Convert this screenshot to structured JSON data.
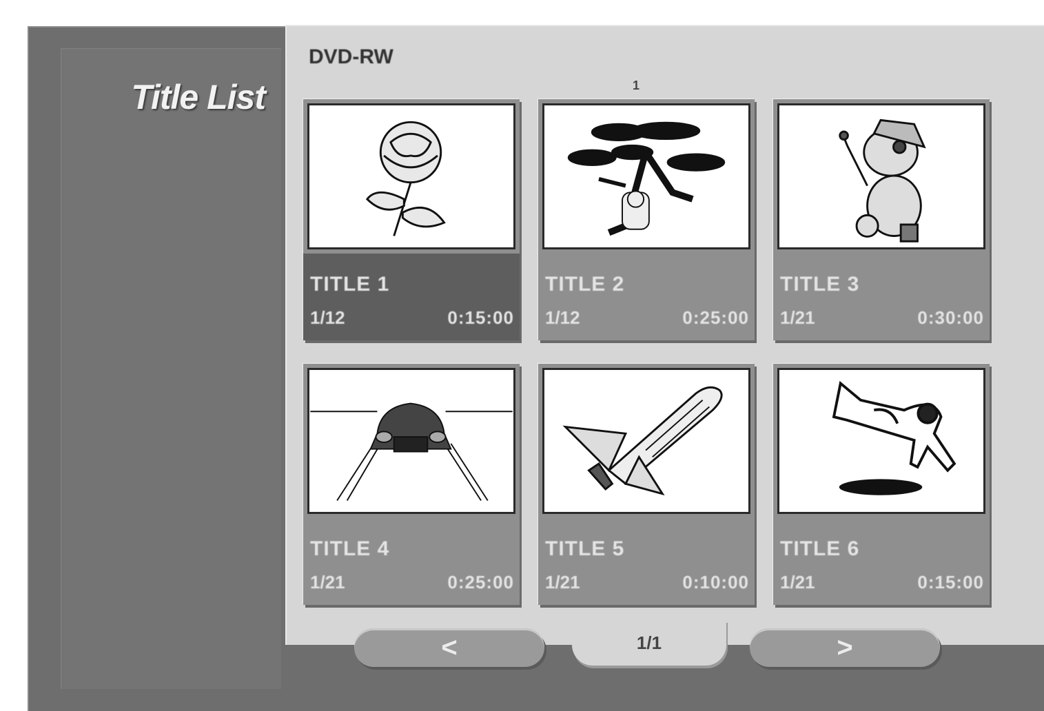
{
  "sidebar": {
    "title": "Title List"
  },
  "header": {
    "disc_label": "DVD-RW",
    "page_marker": "1"
  },
  "titles": [
    {
      "title": "TITLE 1",
      "chapters": "1/12",
      "duration": "0:15:00",
      "thumbnail": "rose-icon",
      "selected": true
    },
    {
      "title": "TITLE 2",
      "chapters": "1/12",
      "duration": "0:25:00",
      "thumbnail": "tree-icon",
      "selected": false
    },
    {
      "title": "TITLE 3",
      "chapters": "1/21",
      "duration": "0:30:00",
      "thumbnail": "cartoon-character-icon",
      "selected": false
    },
    {
      "title": "TITLE 4",
      "chapters": "1/21",
      "duration": "0:25:00",
      "thumbnail": "car-icon",
      "selected": false
    },
    {
      "title": "TITLE 5",
      "chapters": "1/21",
      "duration": "0:10:00",
      "thumbnail": "space-shuttle-icon",
      "selected": false
    },
    {
      "title": "TITLE 6",
      "chapters": "1/21",
      "duration": "0:15:00",
      "thumbnail": "jumping-dog-icon",
      "selected": false
    }
  ],
  "navigation": {
    "prev_label": "<",
    "page_indicator": "1/1",
    "next_label": ">"
  }
}
